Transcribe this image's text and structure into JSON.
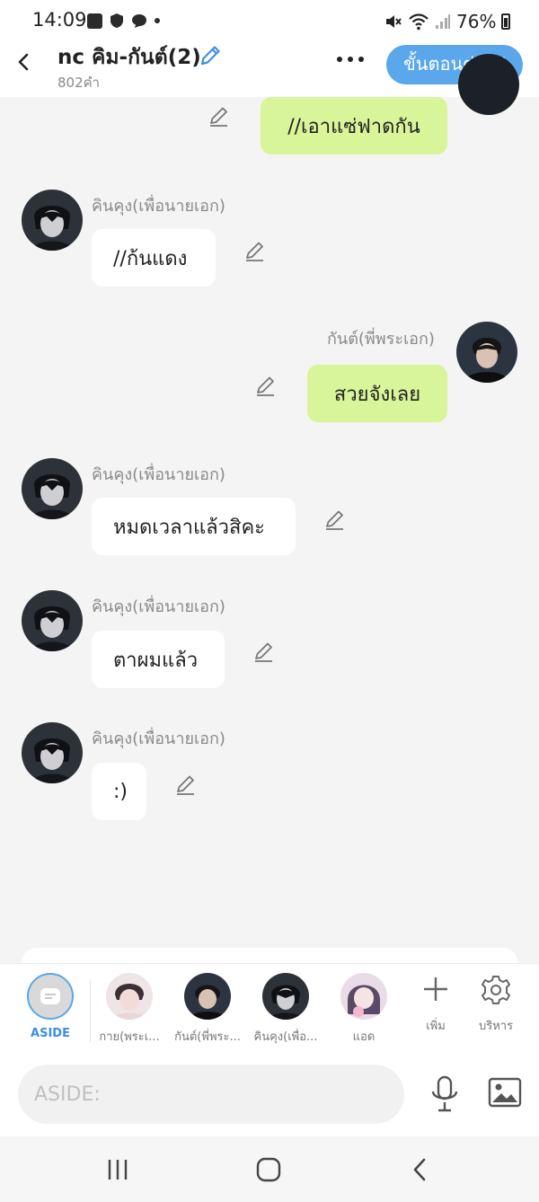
{
  "status": {
    "time": "14:09",
    "battery": "76%"
  },
  "header": {
    "title": "nc คิม-กันต์(2)",
    "subtitle": "802คำ",
    "next_label": "ขั้นตอนต่อไป"
  },
  "messages": [
    {
      "side": "right",
      "text": "//เอาแซ่ฟาดกัน"
    },
    {
      "side": "left",
      "sender": "คินคุง(เพื่อนายเอก)",
      "text": "//ก้นแดง"
    },
    {
      "side": "right",
      "sender": "กันต์(พี่พระเอก)",
      "text": "สวยจังเลย"
    },
    {
      "side": "left",
      "sender": "คินคุง(เพื่อนายเอก)",
      "text": "หมดเวลาแล้วสิคะ"
    },
    {
      "side": "left",
      "sender": "คินคุง(เพื่อนายเอก)",
      "text": "ตาผมแล้ว"
    },
    {
      "side": "left",
      "sender": "คินคุง(เพื่อนายเอก)",
      "text": ":)"
    }
  ],
  "characters": {
    "aside": "ASIDE",
    "items": [
      "กาย(พระเ...",
      "กันต์(พี่พระ...",
      "คินคุง(เพื่อ...",
      "แอด"
    ],
    "add_label": "เพิ่ม",
    "manage_label": "บริหาร"
  },
  "input": {
    "placeholder": "ASIDE:"
  },
  "icons": {
    "back": "back-arrow-icon",
    "title_edit": "pencil-icon",
    "more": "more-dots-icon",
    "edit": "pencil-icon",
    "add": "plus-icon",
    "manage": "gear-icon",
    "mic": "microphone-icon",
    "image": "image-icon",
    "nav_recent": "recent-apps-icon",
    "nav_home": "home-icon",
    "nav_back": "back-icon"
  },
  "colors": {
    "accent": "#5aa7ec",
    "bubble_right": "#d9f59a",
    "bubble_left": "#ffffff",
    "background": "#f4f4f4"
  }
}
